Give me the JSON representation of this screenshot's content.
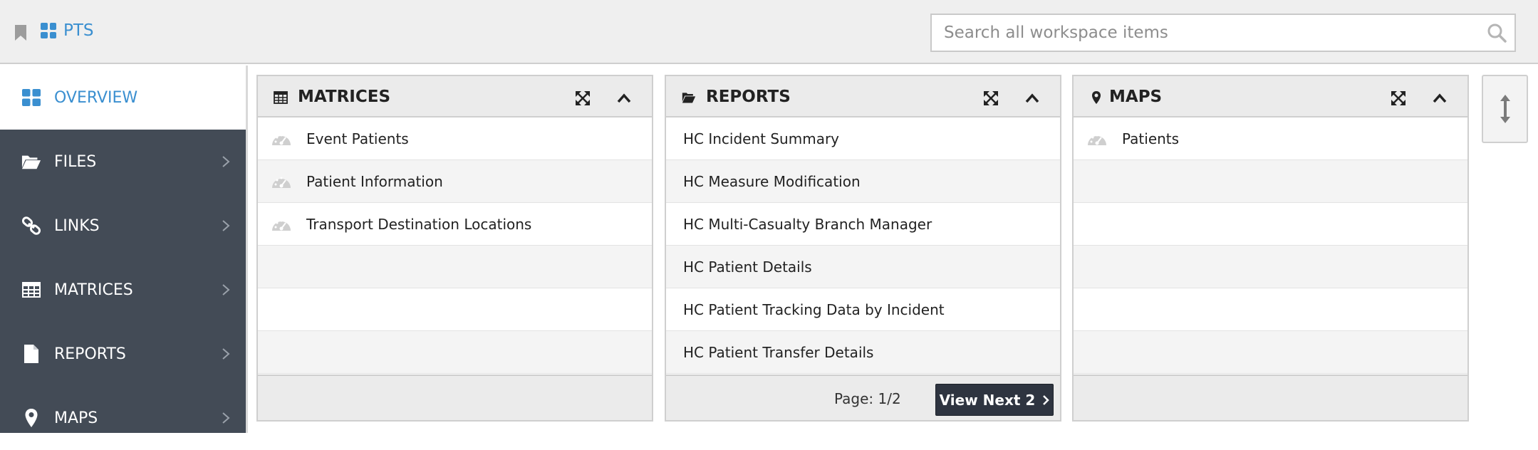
{
  "header": {
    "app_name": "PTS",
    "search_placeholder": "Search all workspace items"
  },
  "sidebar": {
    "items": [
      {
        "label": "OVERVIEW",
        "icon": "grid-icon",
        "active": true
      },
      {
        "label": "FILES",
        "icon": "folder-open-icon"
      },
      {
        "label": "LINKS",
        "icon": "link-icon"
      },
      {
        "label": "MATRICES",
        "icon": "table-icon"
      },
      {
        "label": "REPORTS",
        "icon": "document-icon"
      },
      {
        "label": "MAPS",
        "icon": "map-marker-icon"
      }
    ]
  },
  "panels": {
    "matrices": {
      "title": "MATRICES",
      "items": [
        "Event Patients",
        "Patient Information",
        "Transport Destination Locations"
      ]
    },
    "reports": {
      "title": "REPORTS",
      "items": [
        "HC Incident Summary",
        "HC Measure Modification",
        "HC Multi-Casualty Branch Manager",
        "HC Patient Details",
        "HC Patient Tracking Data by Incident",
        "HC Patient Transfer Details"
      ],
      "page_info": "Page: 1/2",
      "next_label": "View Next 2"
    },
    "maps": {
      "title": "MAPS",
      "items": [
        "Patients"
      ]
    }
  },
  "colors": {
    "accent": "#3a8fd0",
    "sidebar_bg": "#434b56",
    "header_bg": "#efefef",
    "button_dark": "#2e3440"
  }
}
